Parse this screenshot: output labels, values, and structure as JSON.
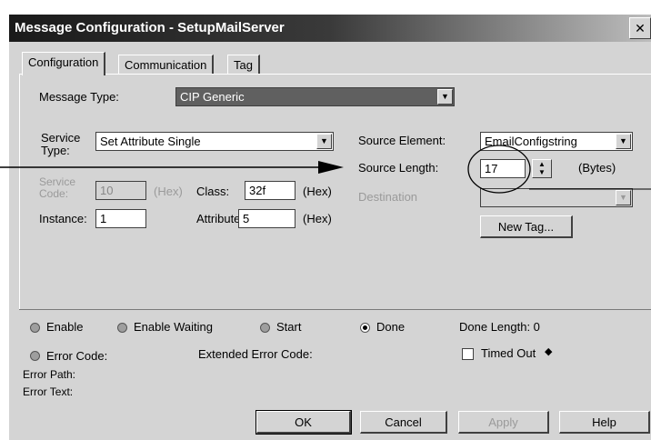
{
  "window": {
    "title": "Message Configuration - SetupMailServer",
    "close_glyph": "✕"
  },
  "tabs": [
    {
      "label": "Configuration",
      "active": true
    },
    {
      "label": "Communication",
      "active": false
    },
    {
      "label": "Tag",
      "active": false
    }
  ],
  "message_type": {
    "label": "Message Type:",
    "value": "CIP Generic"
  },
  "service_type": {
    "label_line1": "Service",
    "label_line2": "Type:",
    "value": "Set Attribute Single"
  },
  "service_code": {
    "label_line1": "Service",
    "label_line2": "Code:",
    "value": "10",
    "unit": "(Hex)"
  },
  "class": {
    "label": "Class:",
    "value": "32f",
    "unit": "(Hex)"
  },
  "instance": {
    "label": "Instance:",
    "value": "1"
  },
  "attribute": {
    "label": "Attribute:",
    "value": "5",
    "unit": "(Hex)"
  },
  "source_element": {
    "label": "Source Element:",
    "value": "EmailConfigstring"
  },
  "source_length": {
    "label": "Source Length:",
    "value": "17",
    "unit": "(Bytes)"
  },
  "destination": {
    "label": "Destination",
    "value": ""
  },
  "new_tag_button": "New Tag...",
  "status": {
    "enable": "Enable",
    "enable_waiting": "Enable Waiting",
    "start": "Start",
    "done": "Done",
    "done_length": "Done Length: 0",
    "error_code": "Error Code:",
    "extended_error_code": "Extended Error Code:",
    "timed_out": "Timed Out",
    "timed_out_arrow": "◆",
    "error_path": "Error Path:",
    "error_text": "Error Text:"
  },
  "buttons": {
    "ok": "OK",
    "cancel": "Cancel",
    "apply": "Apply",
    "help": "Help"
  }
}
